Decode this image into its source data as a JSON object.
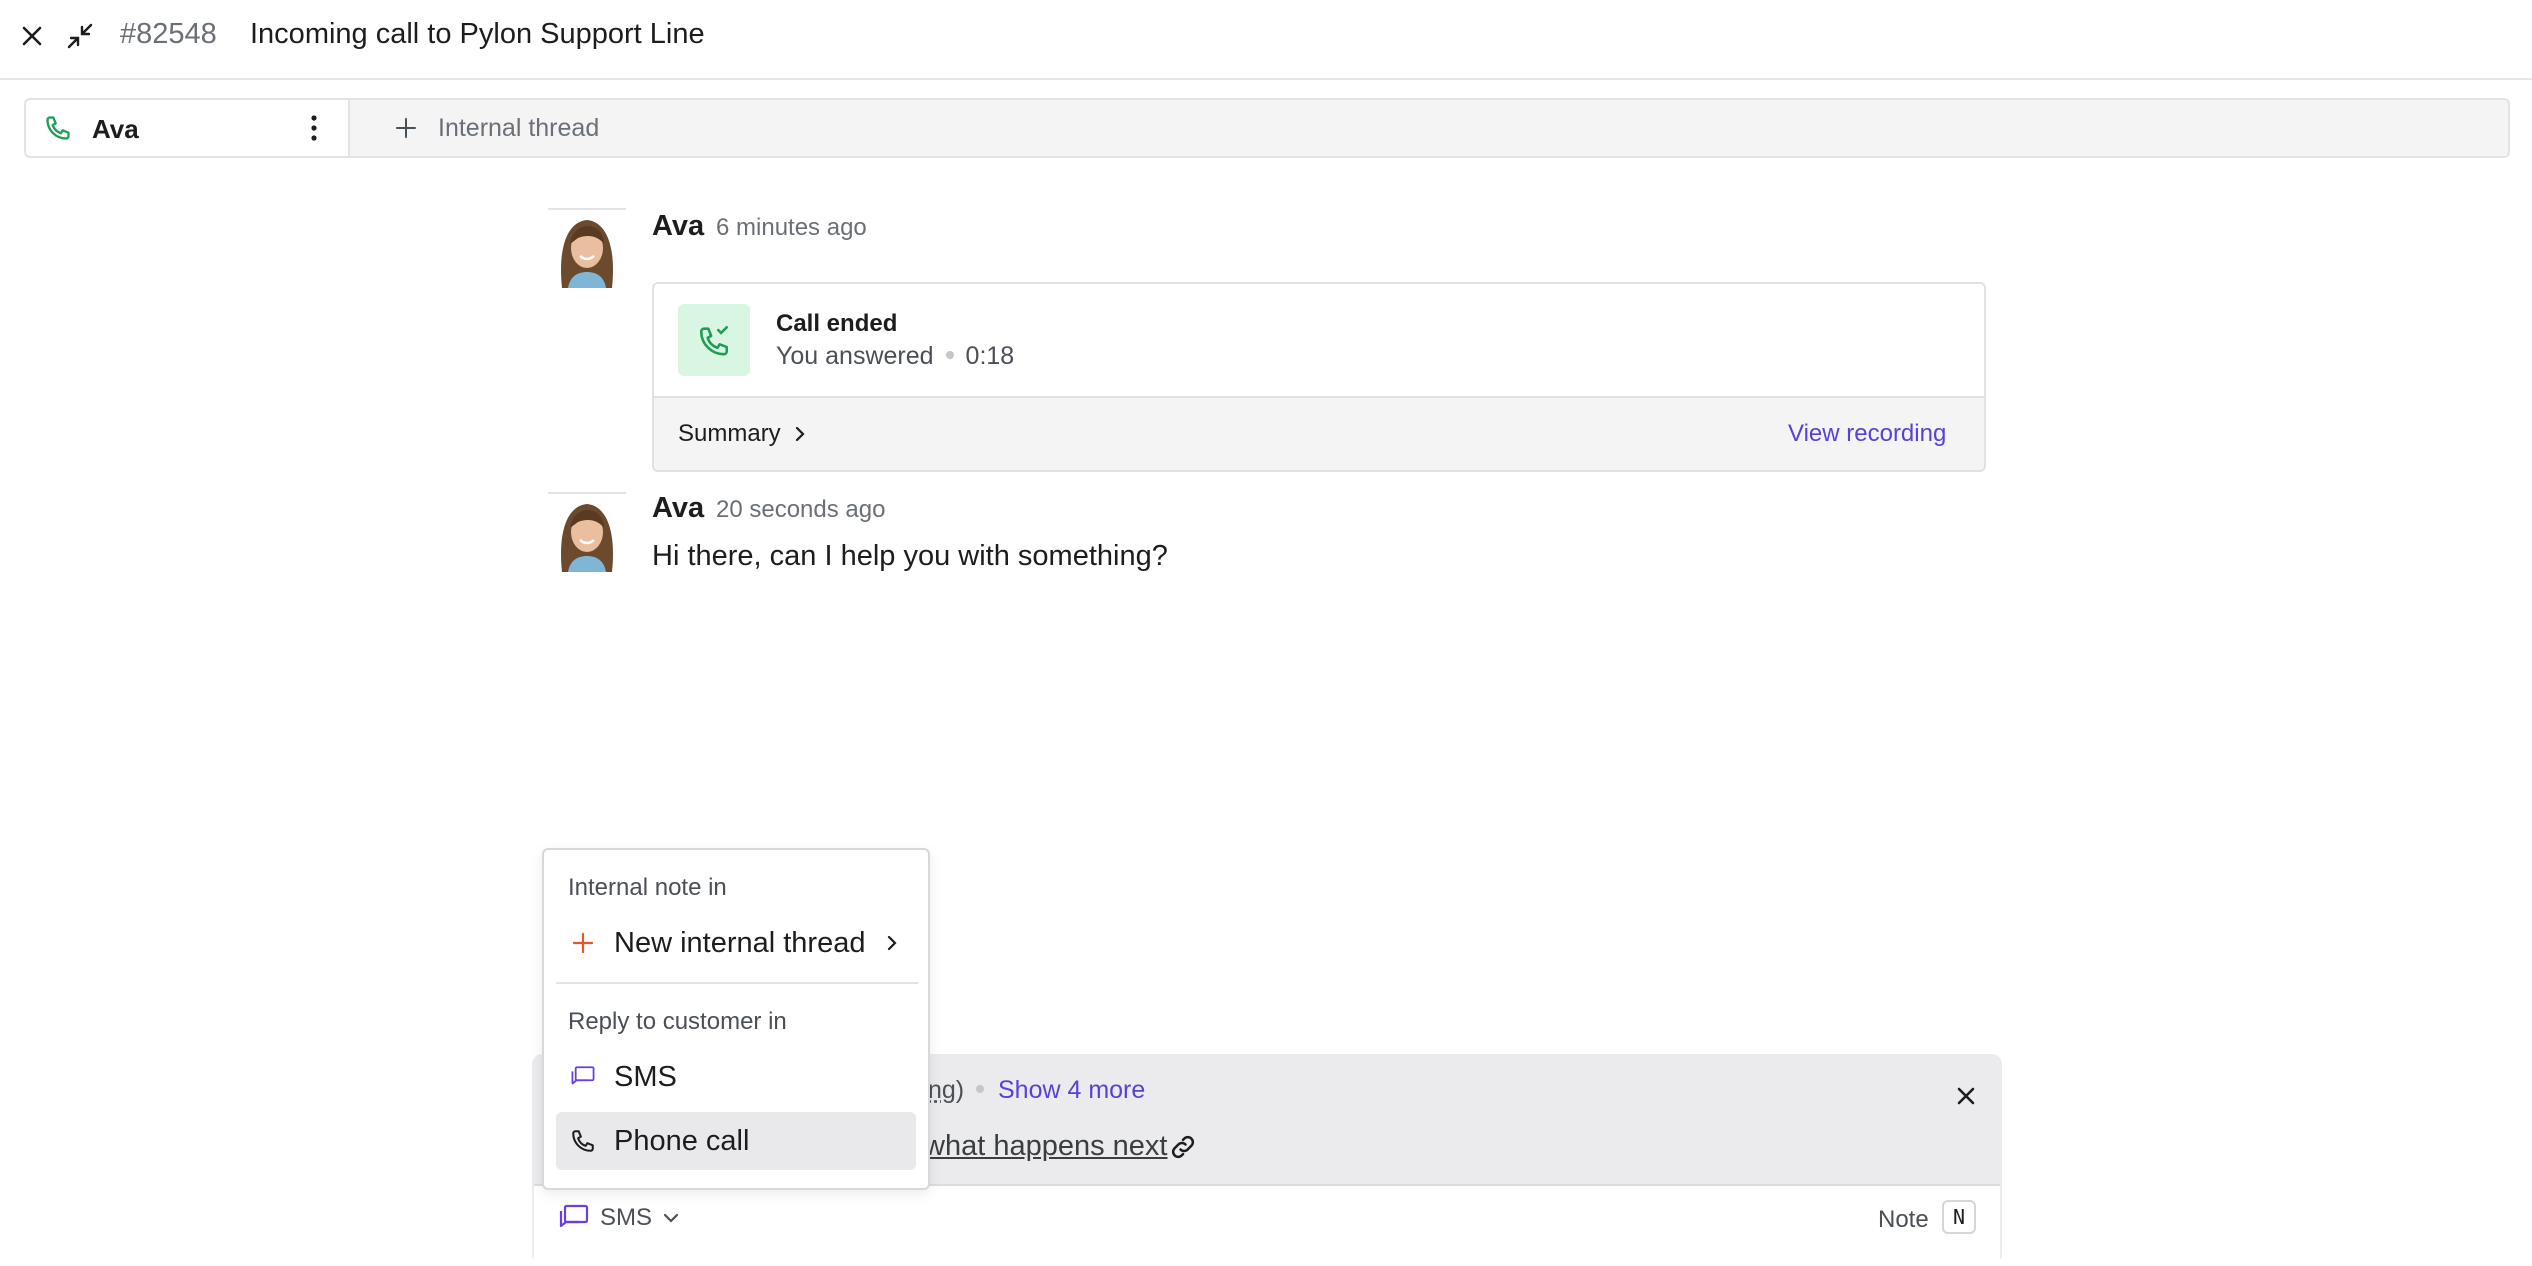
{
  "header": {
    "ticket_id": "#82548",
    "title": "Incoming call to Pylon Support Line",
    "icons": [
      "close-icon",
      "minimize-icon"
    ]
  },
  "threads": {
    "active_tab": {
      "label": "Ava",
      "icon": "phone-icon"
    },
    "add_label": "Internal thread"
  },
  "messages": [
    {
      "author": "Ava",
      "time": "6 minutes ago",
      "call": {
        "title": "Call ended",
        "status": "You answered",
        "duration": "0:18",
        "summary_label": "Summary",
        "recording_label": "View recording"
      }
    },
    {
      "author": "Ava",
      "time": "20 seconds ago",
      "text": "Hi there, can I help you with something?"
    }
  ],
  "composer": {
    "partial_text": "ng)",
    "show_more": "Show 4 more",
    "partial_link": "what happens next",
    "channel_label": "SMS",
    "note_label": "Note",
    "note_shortcut": "N"
  },
  "dropdown": {
    "section_internal": "Internal note in",
    "new_internal_thread": "New internal thread",
    "section_reply": "Reply to customer in",
    "options": [
      {
        "label": "SMS",
        "icon": "message-icon",
        "selected": false
      },
      {
        "label": "Phone call",
        "icon": "phone-icon",
        "selected": true
      }
    ]
  },
  "colors": {
    "accent_purple": "#5b3fd9",
    "phone_green": "#1f9d55",
    "plus_orange": "#e8552a",
    "call_bg": "#d9f6e3"
  }
}
